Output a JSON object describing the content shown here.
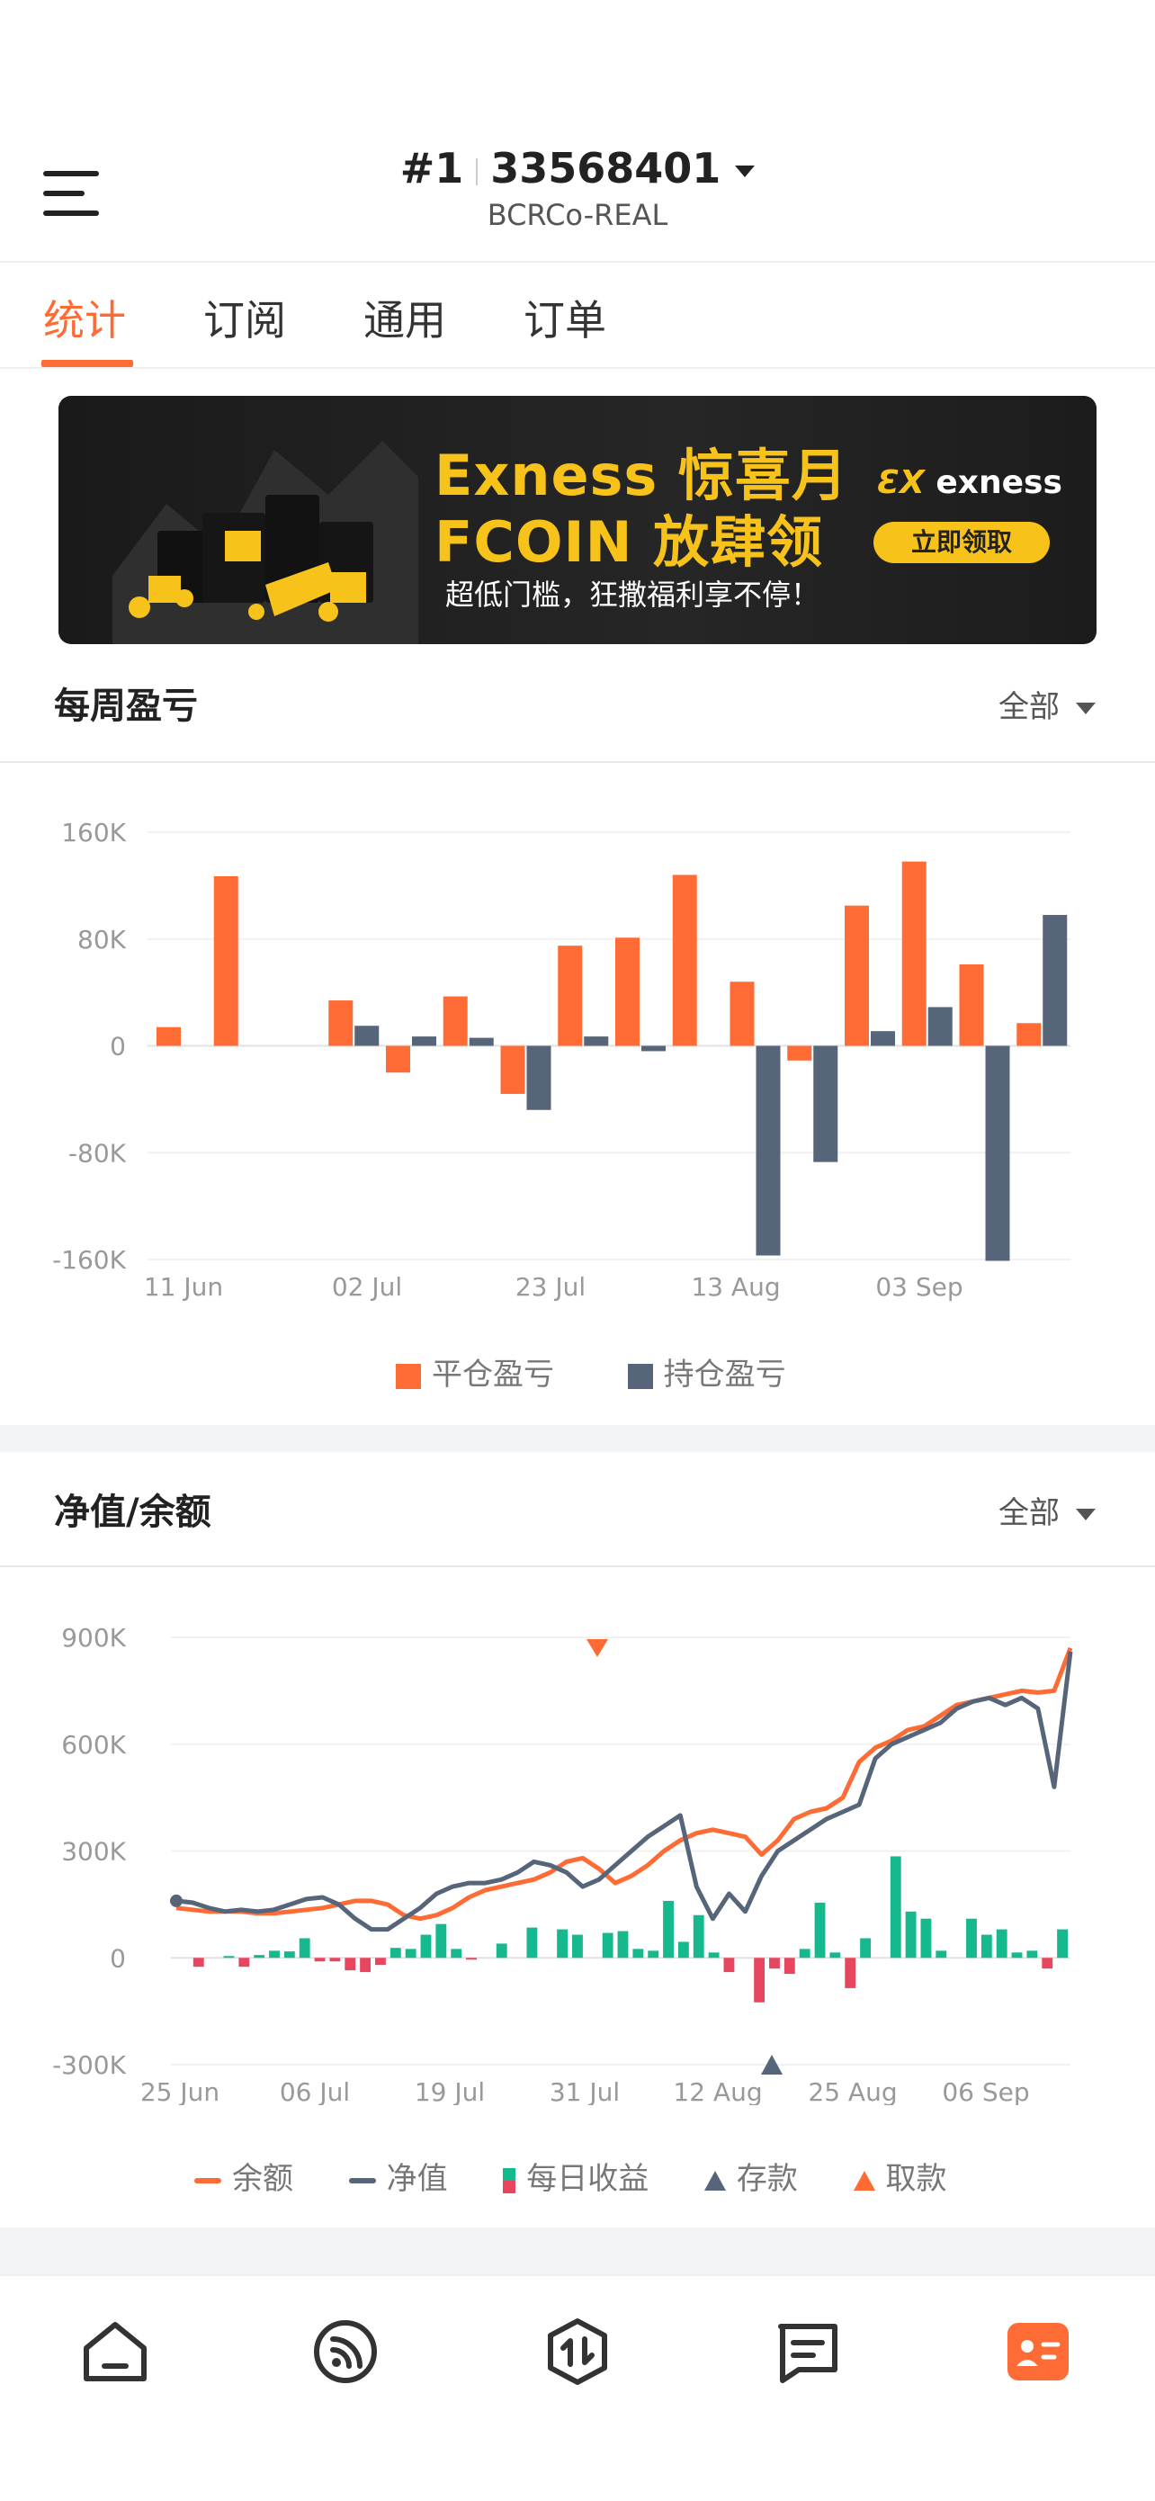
{
  "header": {
    "account_rank": "#1",
    "account_number": "33568401",
    "server": "BCRCo-REAL"
  },
  "tabs": [
    {
      "label": "统计",
      "active": true
    },
    {
      "label": "订阅",
      "active": false
    },
    {
      "label": "通用",
      "active": false
    },
    {
      "label": "订单",
      "active": false
    }
  ],
  "banner": {
    "line1": "Exness 惊喜月",
    "line2": "FCOIN 放肆领",
    "subline": "超低门槛，狂撒福利享不停！",
    "brand": "exness",
    "cta": "立即领取"
  },
  "weekly_pnl": {
    "title": "每周盈亏",
    "filter": "全部",
    "legend_closed": "平仓盈亏",
    "legend_open": "持仓盈亏"
  },
  "equity_balance": {
    "title": "净值/余额",
    "filter": "全部",
    "legend_balance": "余额",
    "legend_equity": "净值",
    "legend_daily": "每日收益",
    "legend_deposit": "存款",
    "legend_withdraw": "取款"
  },
  "colors": {
    "accent": "#ff6b35",
    "slate": "#566579",
    "green": "#16b88e",
    "red": "#e8455f",
    "banner_gold": "#f7c21a"
  },
  "chart_data": [
    {
      "type": "bar",
      "name": "weekly_pnl",
      "x_tick_labels": [
        "11 Jun",
        "02 Jul",
        "23 Jul",
        "13 Aug",
        "03 Sep"
      ],
      "y_tick_labels": [
        "160K",
        "80K",
        "0",
        "-80K",
        "-160K"
      ],
      "ylim": [
        -160000,
        160000
      ],
      "series": [
        {
          "name": "平仓盈亏",
          "color": "#ff6b35",
          "values": [
            14000,
            127000,
            0,
            34000,
            -20000,
            37000,
            -36000,
            75000,
            81000,
            128000,
            48000,
            -11000,
            105000,
            138000,
            61000,
            17000
          ]
        },
        {
          "name": "持仓盈亏",
          "color": "#566579",
          "values": [
            0,
            0,
            0,
            15000,
            7000,
            6000,
            -48000,
            7000,
            -4000,
            0,
            -157000,
            -87000,
            11000,
            29000,
            -161000,
            98000
          ]
        }
      ],
      "grid": true,
      "legend_position": "bottom"
    },
    {
      "type": "line",
      "name": "equity_balance",
      "x_tick_labels": [
        "25 Jun",
        "06 Jul",
        "19 Jul",
        "31 Jul",
        "12 Aug",
        "25 Aug",
        "06 Sep"
      ],
      "y_tick_labels": [
        "900K",
        "600K",
        "300K",
        "0",
        "-300K"
      ],
      "ylim": [
        -300000,
        900000
      ],
      "series": [
        {
          "name": "余额",
          "color": "#ff6b35",
          "values": [
            140000,
            135000,
            130000,
            130000,
            130000,
            125000,
            125000,
            130000,
            135000,
            140000,
            150000,
            160000,
            160000,
            150000,
            120000,
            110000,
            120000,
            140000,
            170000,
            190000,
            200000,
            210000,
            220000,
            240000,
            270000,
            280000,
            250000,
            210000,
            230000,
            260000,
            300000,
            330000,
            350000,
            360000,
            350000,
            340000,
            290000,
            330000,
            390000,
            410000,
            420000,
            450000,
            550000,
            590000,
            610000,
            640000,
            650000,
            680000,
            710000,
            720000,
            730000,
            740000,
            750000,
            745000,
            750000,
            870000
          ]
        },
        {
          "name": "净值",
          "color": "#566579",
          "values": [
            160000,
            155000,
            140000,
            130000,
            135000,
            130000,
            135000,
            150000,
            165000,
            170000,
            150000,
            110000,
            80000,
            80000,
            110000,
            140000,
            180000,
            200000,
            210000,
            210000,
            220000,
            240000,
            270000,
            260000,
            240000,
            200000,
            220000,
            260000,
            300000,
            340000,
            370000,
            400000,
            200000,
            110000,
            180000,
            130000,
            230000,
            300000,
            330000,
            360000,
            390000,
            410000,
            430000,
            560000,
            600000,
            620000,
            640000,
            660000,
            700000,
            720000,
            730000,
            710000,
            730000,
            700000,
            480000,
            860000
          ]
        },
        {
          "name": "每日收益",
          "type": "bar",
          "values": [
            0,
            -25000,
            0,
            5000,
            -25000,
            8000,
            20000,
            18000,
            55000,
            -10000,
            -10000,
            -35000,
            -40000,
            -20000,
            28000,
            25000,
            65000,
            95000,
            25000,
            -5000,
            0,
            40000,
            0,
            85000,
            0,
            80000,
            65000,
            0,
            70000,
            75000,
            25000,
            20000,
            160000,
            45000,
            120000,
            15000,
            -40000,
            0,
            -125000,
            -30000,
            -45000,
            25000,
            155000,
            15000,
            -85000,
            55000,
            0,
            285000,
            130000,
            110000,
            20000,
            0,
            110000,
            65000,
            80000,
            15000,
            20000,
            -30000,
            80000
          ]
        },
        {
          "name": "存款",
          "type": "marker",
          "x_label": "12 Aug"
        },
        {
          "name": "取款",
          "type": "marker",
          "x_label": "31 Jul"
        }
      ],
      "grid": true,
      "legend_position": "bottom"
    }
  ],
  "bottom_nav": [
    {
      "icon": "home-icon",
      "active": false
    },
    {
      "icon": "signal-feed-icon",
      "active": false
    },
    {
      "icon": "trade-icon",
      "active": false
    },
    {
      "icon": "message-icon",
      "active": false
    },
    {
      "icon": "profile-card-icon",
      "active": true
    }
  ]
}
